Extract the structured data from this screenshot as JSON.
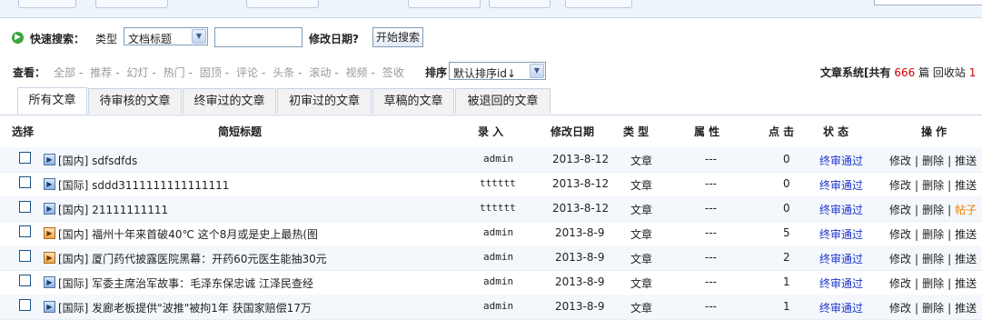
{
  "search": {
    "quick_search_label": "快速搜索：",
    "type_label": "类型",
    "type_value": "文档标题",
    "keyword_value": "",
    "date_label": "修改日期?",
    "start_button": "开始搜索"
  },
  "filters": {
    "view_label": "查看：",
    "items": [
      "全部",
      "推荐",
      "幻灯",
      "热门",
      "固顶",
      "评论",
      "头条",
      "滚动",
      "视频",
      "签收"
    ],
    "sort_label": "排序",
    "sort_value": "默认排序id↓"
  },
  "system": {
    "prefix": "文章系统[共有",
    "count": "666",
    "mid": "篇 回收站",
    "recycle": "1"
  },
  "tabs": [
    "所有文章",
    "待审核的文章",
    "终审过的文章",
    "初审过的文章",
    "草稿的文章",
    "被退回的文章"
  ],
  "columns": {
    "select": "选择",
    "title": "简短标题",
    "author": "录  入",
    "date": "修改日期",
    "type": "类  型",
    "attr": "属  性",
    "clicks": "点  击",
    "status": "状  态",
    "ops": "操  作"
  },
  "rows": [
    {
      "title": "[国内] sdfsdfds",
      "author": "admin",
      "date": "2013-8-12",
      "type": "文章",
      "attr": "---",
      "clicks": "0",
      "status": "终审通过",
      "edit": "修改",
      "del": "删除",
      "push": "推送",
      "icon": "blue"
    },
    {
      "title": "[国际] sddd3111111111111111",
      "author": "tttttt",
      "date": "2013-8-12",
      "type": "文章",
      "attr": "---",
      "clicks": "0",
      "status": "终审通过",
      "edit": "修改",
      "del": "删除",
      "push": "推送",
      "icon": "blue"
    },
    {
      "title": "[国内] 21111111111",
      "author": "tttttt",
      "date": "2013-8-12",
      "type": "文章",
      "attr": "---",
      "clicks": "0",
      "status": "终审通过",
      "edit": "修改",
      "del": "删除",
      "push": "帖子",
      "icon": "blue"
    },
    {
      "title": "[国内] 福州十年来首破40℃ 这个8月或是史上最热(图",
      "author": "admin",
      "date": "2013-8-9",
      "type": "文章",
      "attr": "---",
      "clicks": "5",
      "status": "终审通过",
      "edit": "修改",
      "del": "删除",
      "push": "推送",
      "icon": "orange"
    },
    {
      "title": "[国内] 厦门药代披露医院黑幕：开药60元医生能抽30元",
      "author": "admin",
      "date": "2013-8-9",
      "type": "文章",
      "attr": "---",
      "clicks": "2",
      "status": "终审通过",
      "edit": "修改",
      "del": "删除",
      "push": "推送",
      "icon": "orange"
    },
    {
      "title": "[国际] 军委主席治军故事：毛泽东保忠诚 江泽民查经",
      "author": "admin",
      "date": "2013-8-9",
      "type": "文章",
      "attr": "---",
      "clicks": "1",
      "status": "终审通过",
      "edit": "修改",
      "del": "删除",
      "push": "推送",
      "icon": "blue"
    },
    {
      "title": "[国际] 发廊老板提供\"波推\"被拘1年 获国家赔偿17万",
      "author": "admin",
      "date": "2013-8-9",
      "type": "文章",
      "attr": "---",
      "clicks": "1",
      "status": "终审通过",
      "edit": "修改",
      "del": "删除",
      "push": "推送",
      "icon": "blue"
    }
  ]
}
